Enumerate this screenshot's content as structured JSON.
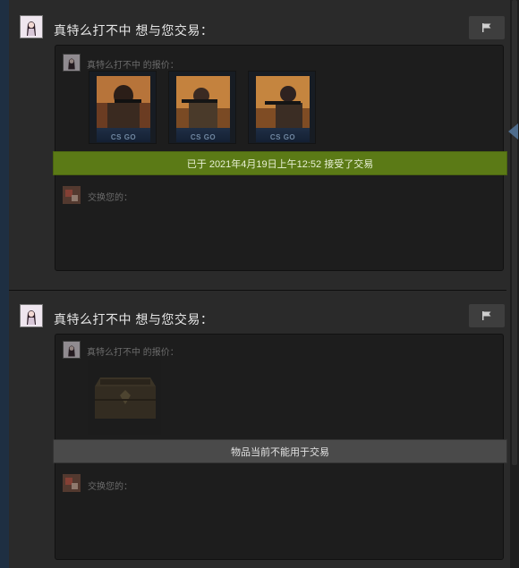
{
  "offers": [
    {
      "title": "真特么打不中 想与您交易：",
      "their_items_label": "真特么打不中 的报价：",
      "items": [
        {
          "name": "csgo-item-1",
          "brand": "CS GO"
        },
        {
          "name": "csgo-item-2",
          "brand": "CS GO"
        },
        {
          "name": "csgo-item-3",
          "brand": "CS GO"
        }
      ],
      "status": "已于 2021年4月19日上午12:52 接受了交易",
      "status_color": "#5b7a16",
      "my_items_label": "交换您的："
    },
    {
      "title": "真特么打不中 想与您交易：",
      "their_items_label": "真特么打不中 的报价：",
      "items": [
        {
          "name": "weapon-case"
        }
      ],
      "status": "物品当前不能用于交易",
      "status_color": "#4a4a4a",
      "my_items_label": "交换您的："
    }
  ],
  "icons": {
    "flag": "flag-icon",
    "avatar": "user-avatar",
    "scroll_arrow": "left-arrow-icon"
  }
}
